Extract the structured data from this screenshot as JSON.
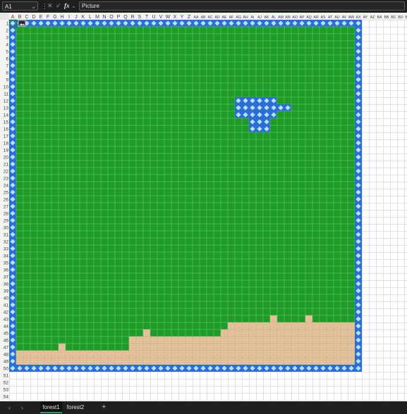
{
  "formula_bar": {
    "name_box": "A1",
    "formula": "Picture"
  },
  "sheet": {
    "columns": [
      "A",
      "B",
      "C",
      "D",
      "E",
      "F",
      "G",
      "H",
      "I",
      "J",
      "K",
      "L",
      "M",
      "N",
      "O",
      "P",
      "Q",
      "R",
      "S",
      "T",
      "U",
      "V",
      "W",
      "X",
      "Y",
      "Z",
      "AA",
      "AB",
      "AC",
      "AD",
      "AE",
      "AF",
      "AG",
      "AH",
      "AI",
      "AJ",
      "AK",
      "AL",
      "AM",
      "AN",
      "AO",
      "AP",
      "AQ",
      "AR",
      "AS",
      "AT",
      "AU",
      "AV",
      "AW",
      "AX",
      "AY",
      "AZ",
      "BA",
      "BB",
      "BC",
      "BD",
      "BE"
    ],
    "row_count": 54,
    "selected_cell": "A1",
    "colors": {
      "grass": "#1e9b28",
      "grass_line": "#55c45a",
      "water": "#2a6fd8",
      "water_light": "#bfe0ff",
      "sand": "#e4c49c",
      "sand_line": "#cfae86",
      "grid_line": "#e1e1e1",
      "header_bg": "#f3f3f3",
      "header_text": "#3c3c3c",
      "selection": "#1a7f45"
    }
  },
  "tabs": {
    "items": [
      {
        "label": "forest1",
        "active": true
      },
      {
        "label": "forest2",
        "active": false
      }
    ],
    "add_label": "+"
  }
}
